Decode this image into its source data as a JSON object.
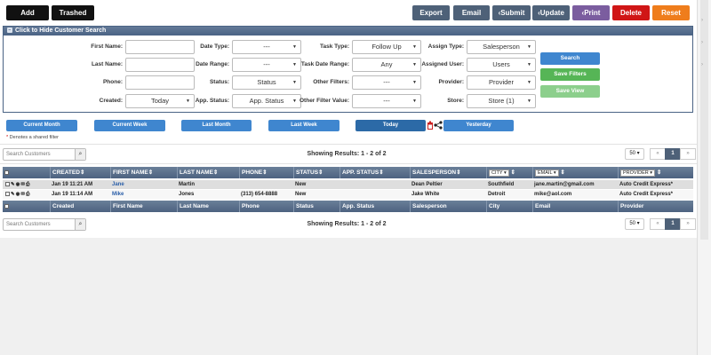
{
  "toolbar": {
    "add_label": "Add",
    "trashed_label": "Trashed",
    "export_label": "Export",
    "email_label": "Email",
    "submit_label": "‹Submit",
    "update_label": "‹Update",
    "print_label": "‹Print",
    "delete_label": "Delete",
    "reset_label": "Reset"
  },
  "panel": {
    "title": "Click to Hide Customer Search",
    "fields": {
      "first_name_label": "First Name:",
      "last_name_label": "Last Name:",
      "phone_label": "Phone:",
      "created_label": "Created:",
      "created_value": "Today",
      "date_type_label": "Date Type:",
      "date_type_value": "---",
      "date_range_label": "Date Range:",
      "date_range_value": "---",
      "status_label": "Status:",
      "status_value": "Status",
      "app_status_label": "App. Status:",
      "app_status_value": "App. Status",
      "task_type_label": "Task Type:",
      "task_type_value": "Follow Up",
      "task_date_range_label": "Task Date Range:",
      "task_date_range_value": "Any",
      "other_filters_label": "Other Filters:",
      "other_filters_value": "---",
      "other_filter_value_label": "Other Filter Value:",
      "other_filter_value_value": "---",
      "assign_type_label": "Assign Type:",
      "assign_type_value": "Salesperson",
      "assigned_user_label": "Assigned User:",
      "assigned_user_value": "Users",
      "provider_label": "Provider:",
      "provider_value": "Provider",
      "store_label": "Store:",
      "store_value": "Store (1)"
    },
    "search_label": "Search",
    "save_filters_label": "Save Filters",
    "save_view_label": "Save View"
  },
  "quick_filters": [
    "Current Month",
    "Current Week",
    "Last Month",
    "Last Week",
    "Today",
    "Yesterday"
  ],
  "shared_note": "Denotes a shared filter",
  "search_placeholder": "Search Customers",
  "showing": "Showing Results: 1 - 2 of 2",
  "pager": {
    "per_page": "50",
    "prev": "«",
    "page": "1",
    "next": "»"
  },
  "table": {
    "headers": [
      "CREATED",
      "FIRST NAME",
      "LAST NAME",
      "PHONE",
      "STATUS",
      "APP. STATUS",
      "SALESPERSON",
      "CITY",
      "EMAIL",
      "PROVIDER"
    ],
    "footers": [
      "Created",
      "First Name",
      "Last Name",
      "Phone",
      "Status",
      "App. Status",
      "Salesperson",
      "City",
      "Email",
      "Provider"
    ],
    "sort_glyph": "⇕",
    "rows": [
      {
        "created": "Jan 19 11:21 AM",
        "first": "Jane",
        "last": "Martin",
        "phone": "",
        "status": "New",
        "app_status": "",
        "salesperson": "Dean Peltier",
        "city": "Southfield",
        "email": "jane.martin@gmail.com",
        "provider": "Auto Credit Express*"
      },
      {
        "created": "Jan 19 11:14 AM",
        "first": "Mike",
        "last": "Jones",
        "phone": "(313) 654-8888",
        "status": "New",
        "app_status": "",
        "salesperson": "Jake White",
        "city": "Detroit",
        "email": "mike@aol.com",
        "provider": "Auto Credit Express*"
      }
    ]
  },
  "colors": {
    "header_blue": "#4a6384",
    "button_blue": "#3f86cf",
    "link_blue": "#2a5ea8",
    "delete_red": "#d01616",
    "reset_orange": "#ef7d1c",
    "print_purple": "#7b5d9f"
  }
}
